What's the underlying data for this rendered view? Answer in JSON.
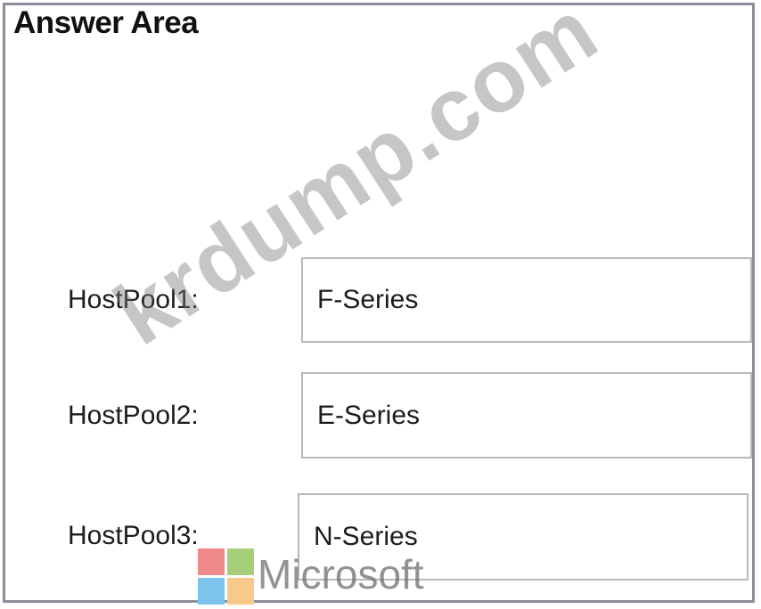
{
  "title": "Answer Area",
  "rows": [
    {
      "label": "HostPool1:",
      "value": "F-Series"
    },
    {
      "label": "HostPool2:",
      "value": "E-Series"
    },
    {
      "label": "HostPool3:",
      "value": "N-Series"
    }
  ],
  "watermark": "krdump.com",
  "brand": {
    "text": "Microsoft",
    "logo_colors": [
      "#f25022",
      "#7fba00",
      "#00a4ef",
      "#ffb900"
    ]
  }
}
